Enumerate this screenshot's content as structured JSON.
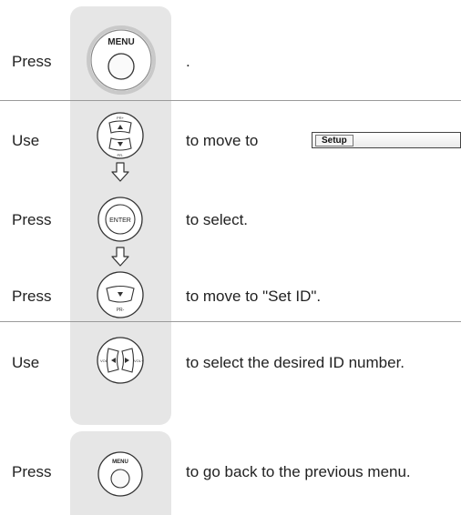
{
  "steps": {
    "s1": {
      "verb": "Press",
      "text": "."
    },
    "s2": {
      "verb": "Use",
      "text": "to move to",
      "box_label": "Setup"
    },
    "s3": {
      "verb": "Press",
      "text": "to select."
    },
    "s4": {
      "verb": "Press",
      "text": "to move to \"Set ID\"."
    },
    "s5": {
      "verb": "Use",
      "text": "to select the desired ID number."
    },
    "s6": {
      "verb": "Press",
      "text": "to go back to the previous menu."
    }
  },
  "buttons": {
    "menu": "MENU",
    "enter": "ENTER",
    "pr_plus": "PR+",
    "pr_minus": "PR-",
    "vol_minus": "VOL-",
    "vol_plus": "VOL+"
  },
  "colors": {
    "panel": "#e6e6e6",
    "divider": "#9a9a9a"
  }
}
